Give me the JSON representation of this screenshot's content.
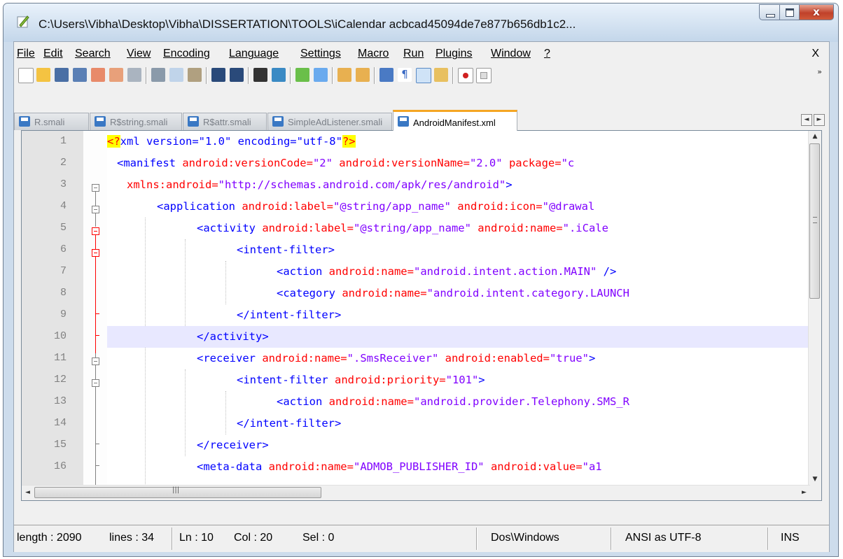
{
  "window": {
    "title": "C:\\Users\\Vibha\\Desktop\\Vibha\\DISSERTATION\\TOOLS\\iCalendar acbcad45094de7e877b656db1c2...",
    "close_glyph": "x"
  },
  "menu": {
    "items": [
      "File",
      "Edit",
      "Search",
      "View",
      "Encoding",
      "Language",
      "Settings",
      "Macro",
      "Run",
      "Plugins",
      "Window",
      "?"
    ],
    "close_doc": "X"
  },
  "toolbar": {
    "icons": [
      "new-file-icon",
      "open-file-icon",
      "save-icon",
      "save-all-icon",
      "close-icon",
      "close-all-icon",
      "print-icon",
      "cut-icon",
      "copy-icon",
      "paste-icon",
      "undo-icon",
      "redo-icon",
      "find-icon",
      "replace-icon",
      "zoom-in-icon",
      "zoom-out-icon",
      "sync-vertical-icon",
      "sync-horizontal-icon",
      "word-wrap-icon",
      "show-all-chars-icon",
      "indent-guide-icon",
      "function-list-icon",
      "record-macro-icon",
      "stop-macro-icon"
    ],
    "more": "»"
  },
  "tabs": [
    {
      "label": "R.smali",
      "active": false
    },
    {
      "label": "R$string.smali",
      "active": false
    },
    {
      "label": "R$attr.smali",
      "active": false
    },
    {
      "label": "SimpleAdListener.smali",
      "active": false
    },
    {
      "label": "AndroidManifest.xml",
      "active": true
    }
  ],
  "editor": {
    "current_line": 10,
    "lines": [
      {
        "n": "1",
        "parts": [
          [
            "pi",
            "<?"
          ],
          [
            "pitxt",
            "xml version=\"1.0\" encoding=\"utf-8\""
          ],
          [
            "pi",
            "?>"
          ]
        ]
      },
      {
        "n": "2",
        "parts": [
          [
            "tag",
            "<manifest "
          ],
          [
            "attr",
            "android:versionCode="
          ],
          [
            "val",
            "\"2\" "
          ],
          [
            "attr",
            "android:versionName="
          ],
          [
            "val",
            "\"2.0\" "
          ],
          [
            "attr",
            "package="
          ],
          [
            "val",
            "\"c"
          ]
        ]
      },
      {
        "n": "3",
        "parts": [
          [
            "attr",
            "xmlns:android="
          ],
          [
            "val",
            "\"http://schemas.android.com/apk/res/android\""
          ],
          [
            "tag",
            ">"
          ]
        ]
      },
      {
        "n": "4",
        "parts": [
          [
            "tag",
            "<application "
          ],
          [
            "attr",
            "android:label="
          ],
          [
            "val",
            "\"@string/app_name\" "
          ],
          [
            "attr",
            "android:icon="
          ],
          [
            "val",
            "\"@drawal"
          ]
        ]
      },
      {
        "n": "5",
        "parts": [
          [
            "tag",
            "<activity "
          ],
          [
            "attr",
            "android:label="
          ],
          [
            "val",
            "\"@string/app_name\" "
          ],
          [
            "attr",
            "android:name="
          ],
          [
            "val",
            "\".iCale"
          ]
        ]
      },
      {
        "n": "6",
        "parts": [
          [
            "tag",
            "<intent-filter>"
          ]
        ]
      },
      {
        "n": "7",
        "parts": [
          [
            "tag",
            "<action "
          ],
          [
            "attr",
            "android:name="
          ],
          [
            "val",
            "\"android.intent.action.MAIN\" "
          ],
          [
            "tag",
            "/>"
          ]
        ]
      },
      {
        "n": "8",
        "parts": [
          [
            "tag",
            "<category "
          ],
          [
            "attr",
            "android:name="
          ],
          [
            "val",
            "\"android.intent.category.LAUNCH"
          ]
        ]
      },
      {
        "n": "9",
        "parts": [
          [
            "tag",
            "</intent-filter>"
          ]
        ]
      },
      {
        "n": "10",
        "parts": [
          [
            "tag",
            "</activity>"
          ]
        ]
      },
      {
        "n": "11",
        "parts": [
          [
            "tag",
            "<receiver "
          ],
          [
            "attr",
            "android:name="
          ],
          [
            "val",
            "\".SmsReceiver\" "
          ],
          [
            "attr",
            "android:enabled="
          ],
          [
            "val",
            "\"true\""
          ],
          [
            "tag",
            ">"
          ]
        ]
      },
      {
        "n": "12",
        "parts": [
          [
            "tag",
            "<intent-filter "
          ],
          [
            "attr",
            "android:priority="
          ],
          [
            "val",
            "\"101\""
          ],
          [
            "tag",
            ">"
          ]
        ]
      },
      {
        "n": "13",
        "parts": [
          [
            "tag",
            "<action "
          ],
          [
            "attr",
            "android:name="
          ],
          [
            "val",
            "\"android.provider.Telephony.SMS_R"
          ]
        ]
      },
      {
        "n": "14",
        "parts": [
          [
            "tag",
            "</intent-filter>"
          ]
        ]
      },
      {
        "n": "15",
        "parts": [
          [
            "tag",
            "</receiver>"
          ]
        ]
      },
      {
        "n": "16",
        "parts": [
          [
            "tag",
            "<meta-data "
          ],
          [
            "attr",
            "android:name="
          ],
          [
            "val",
            "\"ADMOB_PUBLISHER_ID\" "
          ],
          [
            "attr",
            "android:value="
          ],
          [
            "val",
            "\"a1"
          ]
        ]
      }
    ]
  },
  "status": {
    "length": "length : 2090",
    "lines": "lines : 34",
    "ln": "Ln : 10",
    "col": "Col : 20",
    "sel": "Sel : 0",
    "eol": "Dos\\Windows",
    "encoding": "ANSI as UTF-8",
    "mode": "INS"
  }
}
